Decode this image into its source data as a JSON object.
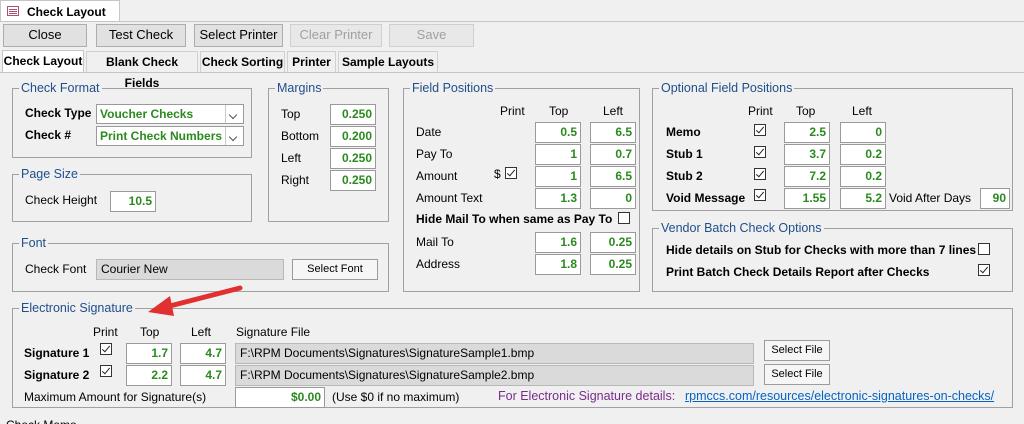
{
  "window": {
    "title": "Check Layout"
  },
  "toolbar": {
    "close": "Close",
    "test_check": "Test Check",
    "select_printer": "Select Printer",
    "clear_printer": "Clear Printer",
    "save": "Save"
  },
  "tabs": [
    "Check Layout",
    "Blank Check Fields",
    "Check Sorting",
    "Printer",
    "Sample Layouts"
  ],
  "check_format": {
    "legend": "Check Format",
    "check_type_label": "Check Type",
    "check_type_value": "Voucher Checks",
    "check_num_label": "Check #",
    "check_num_value": "Print Check Numbers"
  },
  "page_size": {
    "legend": "Page Size",
    "check_height_label": "Check Height",
    "check_height_value": "10.5"
  },
  "font": {
    "legend": "Font",
    "check_font_label": "Check Font",
    "check_font_value": "Courier New",
    "select_font": "Select Font"
  },
  "margins": {
    "legend": "Margins",
    "rows": [
      {
        "label": "Top",
        "value": "0.250"
      },
      {
        "label": "Bottom",
        "value": "0.200"
      },
      {
        "label": "Left",
        "value": "0.250"
      },
      {
        "label": "Right",
        "value": "0.250"
      }
    ]
  },
  "field_positions": {
    "legend": "Field Positions",
    "hdr_print": "Print",
    "hdr_top": "Top",
    "hdr_left": "Left",
    "rows": [
      {
        "label": "Date",
        "top": "0.5",
        "left": "6.5"
      },
      {
        "label": "Pay To",
        "top": "1",
        "left": "0.7"
      },
      {
        "label": "Amount",
        "top": "1",
        "left": "6.5"
      },
      {
        "label": "Amount Text",
        "top": "1.3",
        "left": "0"
      }
    ],
    "amount_dollar": "$",
    "hide_mail_to": "Hide Mail To when same as Pay To",
    "rows2": [
      {
        "label": "Mail To",
        "top": "1.6",
        "left": "0.25"
      },
      {
        "label": "Address",
        "top": "1.8",
        "left": "0.25"
      }
    ]
  },
  "optional_positions": {
    "legend": "Optional Field Positions",
    "hdr_print": "Print",
    "hdr_top": "Top",
    "hdr_left": "Left",
    "rows": [
      {
        "label": "Memo",
        "top": "2.5",
        "left": "0"
      },
      {
        "label": "Stub 1",
        "top": "3.7",
        "left": "0.2"
      },
      {
        "label": "Stub 2",
        "top": "7.2",
        "left": "0.2"
      },
      {
        "label": "Void Message",
        "top": "1.55",
        "left": "5.2"
      }
    ],
    "void_after_days_label": "Void After Days",
    "void_after_days_value": "90"
  },
  "vendor_batch": {
    "legend": "Vendor Batch Check Options",
    "hide_details": "Hide details on Stub for Checks with more than 7 lines",
    "print_report": "Print Batch Check Details Report after Checks"
  },
  "esig": {
    "legend": "Electronic Signature",
    "hdr_print": "Print",
    "hdr_top": "Top",
    "hdr_left": "Left",
    "hdr_file": "Signature File",
    "rows": [
      {
        "label": "Signature 1",
        "top": "1.7",
        "left": "4.7",
        "file": "F:\\RPM Documents\\Signatures\\SignatureSample1.bmp"
      },
      {
        "label": "Signature 2",
        "top": "2.2",
        "left": "4.7",
        "file": "F:\\RPM Documents\\Signatures\\SignatureSample2.bmp"
      }
    ],
    "select_file": "Select File",
    "max_label": "Maximum Amount for Signature(s)",
    "max_value": "$0.00",
    "max_hint": "(Use $0 if no maximum)",
    "details_label": "For Electronic Signature details:",
    "details_link": "rpmccs.com/resources/electronic-signatures-on-checks/"
  },
  "bottom_cut_label": "Check Memo",
  "colors": {
    "accent": "#1f4e8c",
    "value_green": "#2a8a1e",
    "arrow_red": "#e03030",
    "link": "#0563c1"
  }
}
